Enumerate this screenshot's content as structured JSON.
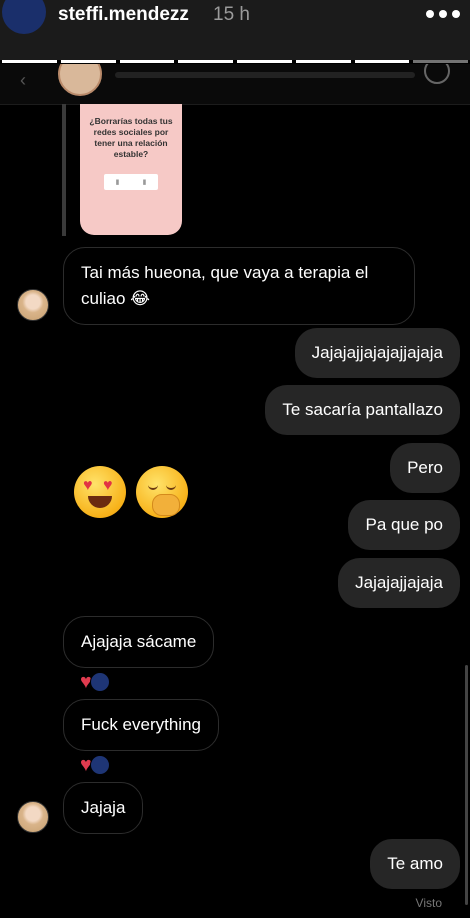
{
  "story": {
    "username": "steffi.mendezz",
    "time": "15 h",
    "progress_total": 8,
    "progress_completed": 7
  },
  "shared_post": {
    "question": "¿Borrarías todas tus redes sociales por tener una relación estable?"
  },
  "messages": [
    {
      "side": "in",
      "text": "Tai más hueona, que vaya a terapia el culiao 😂"
    },
    {
      "side": "out",
      "text": "Jajajajjajajajjajaja"
    },
    {
      "side": "out",
      "text": "Te sacaría pantallazo"
    },
    {
      "side": "out",
      "emojis": [
        "heart-eyes-emoji",
        "hand-over-mouth-emoji"
      ]
    },
    {
      "side": "out",
      "text": "Pero"
    },
    {
      "side": "out",
      "text": "Pa que po"
    },
    {
      "side": "out",
      "text": "Jajajajjajaja"
    },
    {
      "side": "in",
      "text": "Ajajaja sácame",
      "reactions": [
        "heart",
        "blue-avatar"
      ]
    },
    {
      "side": "in",
      "text": "Fuck everything",
      "reactions": [
        "heart",
        "blue-avatar"
      ]
    },
    {
      "side": "in",
      "text": "Jajaja"
    },
    {
      "side": "out",
      "text": "Te amo"
    }
  ],
  "status": {
    "seen": "Visto"
  },
  "colors": {
    "background": "#000000",
    "outgoing_bubble": "#262626",
    "incoming_border": "#2c2c2c",
    "heart": "#e03b4f",
    "story_avatar": "#1a2f6b"
  }
}
